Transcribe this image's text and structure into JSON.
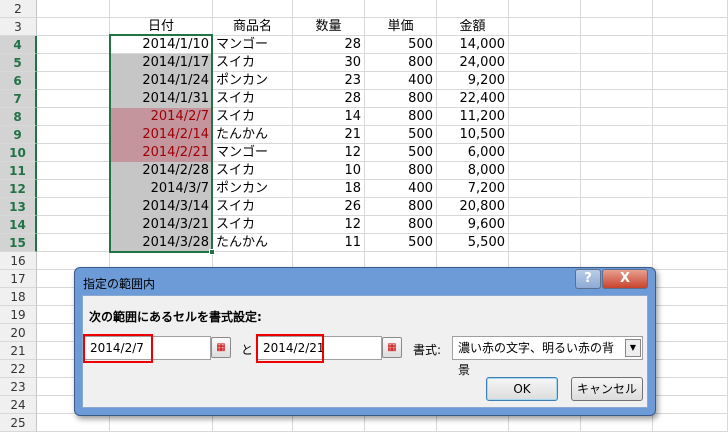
{
  "rows": [
    {
      "n": "2",
      "date": "",
      "item": "",
      "qty": "",
      "price": "",
      "amount": ""
    },
    {
      "n": "3",
      "date": "日付",
      "item": "商品名",
      "qty": "数量",
      "price": "単価",
      "amount": "金額",
      "header": true
    },
    {
      "n": "4",
      "date": "2014/1/10",
      "item": "マンゴー",
      "qty": "28",
      "price": "500",
      "amount": "14,000",
      "fill": "none"
    },
    {
      "n": "5",
      "date": "2014/1/17",
      "item": "スイカ",
      "qty": "30",
      "price": "800",
      "amount": "24,000",
      "fill": "gray"
    },
    {
      "n": "6",
      "date": "2014/1/24",
      "item": "ポンカン",
      "qty": "23",
      "price": "400",
      "amount": "9,200",
      "fill": "gray"
    },
    {
      "n": "7",
      "date": "2014/1/31",
      "item": "スイカ",
      "qty": "28",
      "price": "800",
      "amount": "22,400",
      "fill": "gray"
    },
    {
      "n": "8",
      "date": "2014/2/7",
      "item": "スイカ",
      "qty": "14",
      "price": "800",
      "amount": "11,200",
      "fill": "red"
    },
    {
      "n": "9",
      "date": "2014/2/14",
      "item": "たんかん",
      "qty": "21",
      "price": "500",
      "amount": "10,500",
      "fill": "red"
    },
    {
      "n": "10",
      "date": "2014/2/21",
      "item": "マンゴー",
      "qty": "12",
      "price": "500",
      "amount": "6,000",
      "fill": "red"
    },
    {
      "n": "11",
      "date": "2014/2/28",
      "item": "スイカ",
      "qty": "10",
      "price": "800",
      "amount": "8,000",
      "fill": "gray"
    },
    {
      "n": "12",
      "date": "2014/3/7",
      "item": "ポンカン",
      "qty": "18",
      "price": "400",
      "amount": "7,200",
      "fill": "gray"
    },
    {
      "n": "13",
      "date": "2014/3/14",
      "item": "スイカ",
      "qty": "26",
      "price": "800",
      "amount": "20,800",
      "fill": "gray"
    },
    {
      "n": "14",
      "date": "2014/3/21",
      "item": "スイカ",
      "qty": "12",
      "price": "800",
      "amount": "9,600",
      "fill": "gray"
    },
    {
      "n": "15",
      "date": "2014/3/28",
      "item": "たんかん",
      "qty": "11",
      "price": "500",
      "amount": "5,500",
      "fill": "gray"
    },
    {
      "n": "16"
    },
    {
      "n": "17"
    },
    {
      "n": "18"
    },
    {
      "n": "19"
    },
    {
      "n": "20"
    },
    {
      "n": "21"
    },
    {
      "n": "22"
    },
    {
      "n": "23"
    },
    {
      "n": "24"
    },
    {
      "n": "25"
    }
  ],
  "dialog": {
    "title": "指定の範囲内",
    "help": "?",
    "close": "X",
    "instruction": "次の範囲にあるセルを書式設定:",
    "from": "2014/2/7",
    "and": "と",
    "to": "2014/2/21",
    "format_label": "書式:",
    "format_value": "濃い赤の文字、明るい赤の背景",
    "ok": "OK",
    "cancel": "キャンセル"
  }
}
